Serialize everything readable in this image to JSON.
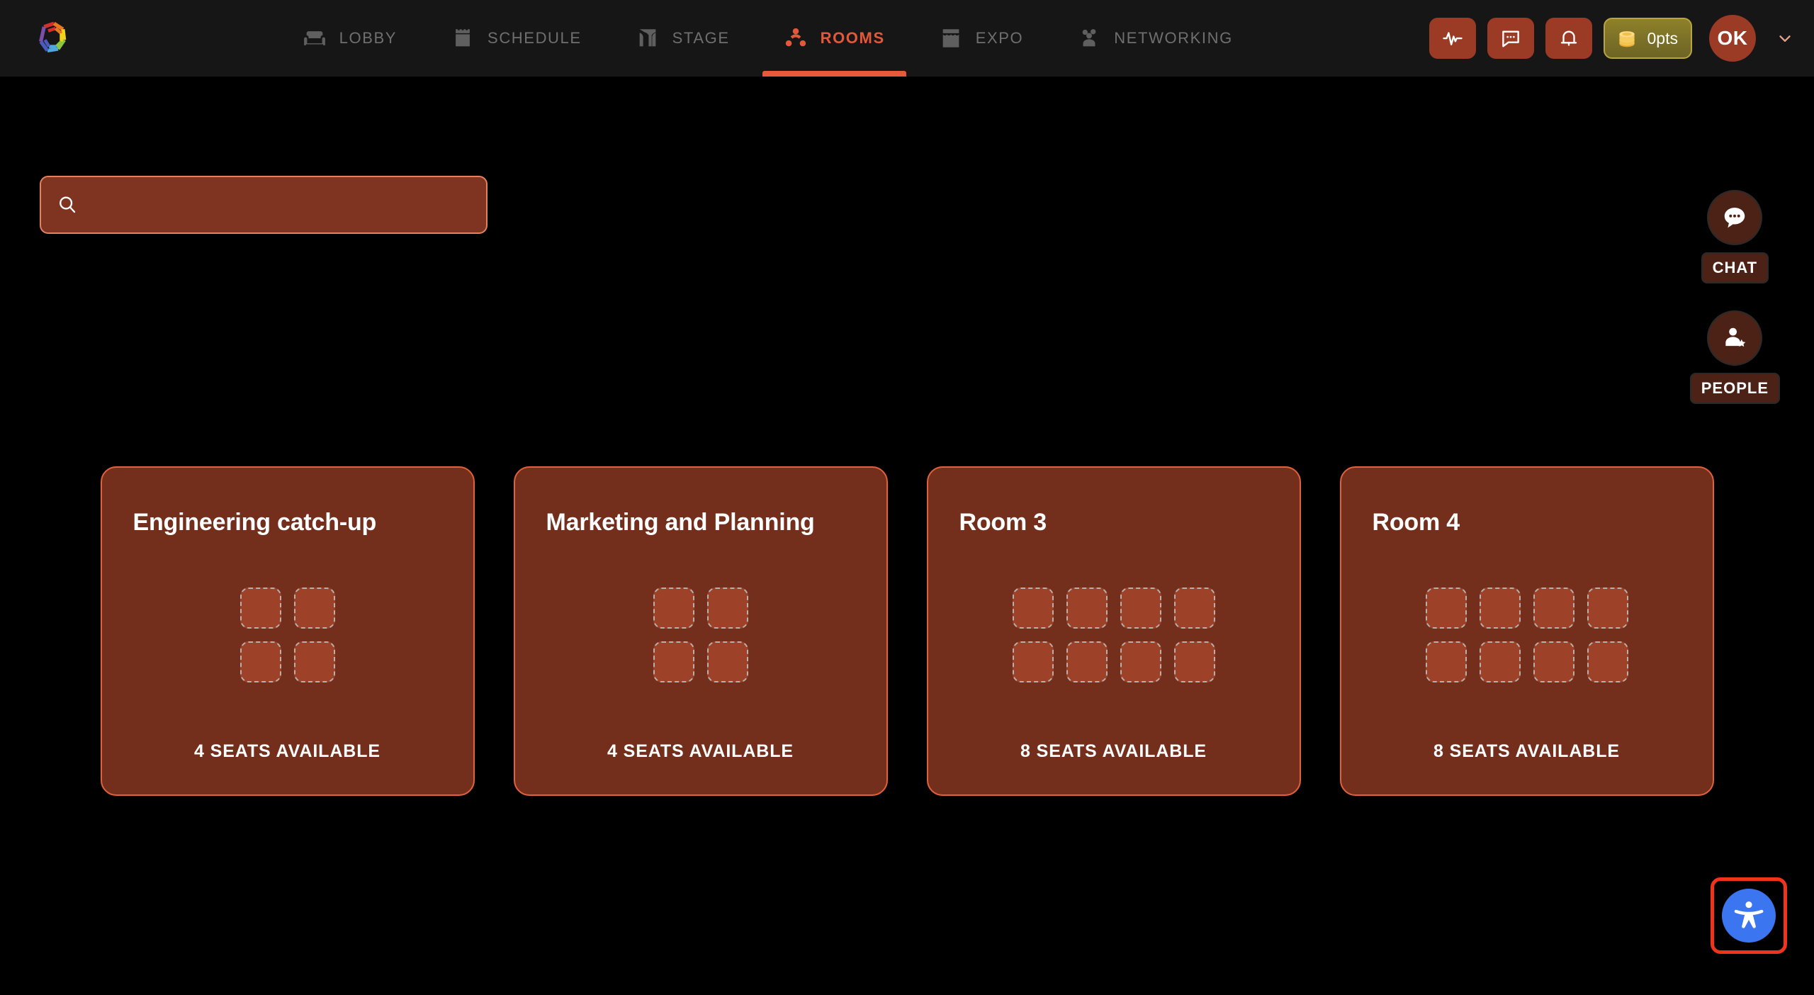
{
  "brand": {
    "logo_icon": "rainbow-hex-spiral-logo",
    "logo_colors": [
      "#d32f2f",
      "#e87722",
      "#f2d21b",
      "#8cc63e",
      "#4fa8dd",
      "#4a5bbf",
      "#7b4fa8"
    ]
  },
  "nav": {
    "items": [
      {
        "label": "LOBBY",
        "icon": "sofa-icon",
        "active": false
      },
      {
        "label": "SCHEDULE",
        "icon": "calendar-icon",
        "active": false
      },
      {
        "label": "STAGE",
        "icon": "stage-curtain-icon",
        "active": false
      },
      {
        "label": "ROOMS",
        "icon": "people-circle-icon",
        "active": true
      },
      {
        "label": "EXPO",
        "icon": "storefront-icon",
        "active": false
      },
      {
        "label": "NETWORKING",
        "icon": "people-group-icon",
        "active": false
      }
    ],
    "active_color": "#e2593a",
    "inactive_color": "#6f6f6f",
    "underline_color": "#e8583a",
    "bar_background": "#161616"
  },
  "nav_actions": {
    "activity": {
      "icon": "activity-pulse-icon",
      "label": "Activity"
    },
    "messages": {
      "icon": "chat-bubble-icon",
      "label": "Messages"
    },
    "notifications": {
      "icon": "bell-icon",
      "label": "Notifications"
    },
    "points": {
      "icon": "coin-stack-icon",
      "label": "0pts"
    },
    "avatar": {
      "initials": "OK",
      "caret_icon": "chevron-down-icon"
    }
  },
  "search": {
    "icon": "search-icon",
    "value": "",
    "placeholder": ""
  },
  "rooms": [
    {
      "title": "Engineering catch-up",
      "seats_total": 4,
      "columns": 2,
      "seats_label": "4 SEATS AVAILABLE"
    },
    {
      "title": "Marketing and Planning",
      "seats_total": 4,
      "columns": 2,
      "seats_label": "4 SEATS AVAILABLE"
    },
    {
      "title": "Room 3",
      "seats_total": 8,
      "columns": 4,
      "seats_label": "8 SEATS AVAILABLE"
    },
    {
      "title": "Room 4",
      "seats_total": 8,
      "columns": 4,
      "seats_label": "8 SEATS AVAILABLE"
    }
  ],
  "side_rail": [
    {
      "label": "CHAT",
      "icon": "chat-bubble-dots-icon"
    },
    {
      "label": "PEOPLE",
      "icon": "person-star-icon"
    }
  ],
  "accessibility": {
    "icon": "accessibility-person-icon",
    "circle_color": "#3b75ef",
    "focus_outline_color": "#f0341c"
  },
  "theme": {
    "page_background": "#000000",
    "card_background": "#742f1c",
    "card_border": "#e2603c",
    "seat_fill": "#9d4129",
    "seat_border": "#b8b0aa",
    "accent": "#e2593a"
  }
}
